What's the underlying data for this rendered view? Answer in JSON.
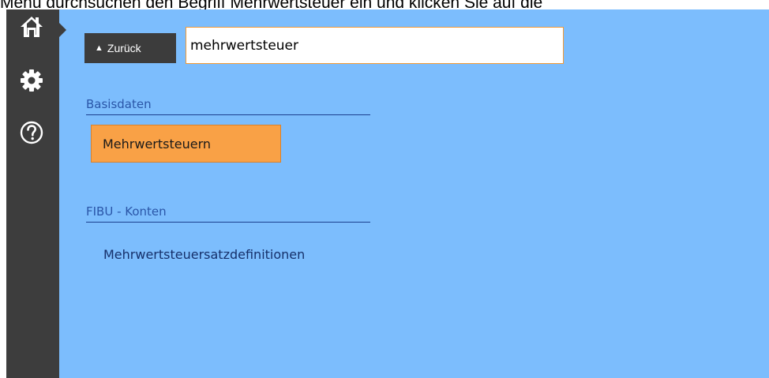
{
  "caption": "Menü durchsuchen den Begriff Mehrwertsteuer ein und klicken Sie auf die",
  "sidebar": {
    "items": [
      {
        "icon": "home-icon"
      },
      {
        "icon": "gear-icon"
      },
      {
        "icon": "help-icon"
      }
    ]
  },
  "toolbar": {
    "back_label": "Zurück"
  },
  "search": {
    "value": "mehrwertsteuer"
  },
  "results": {
    "sections": [
      {
        "title": "Basisdaten",
        "items": [
          "Mehrwertsteuern"
        ]
      },
      {
        "title": "FIBU - Konten",
        "items": [
          "Mehrwertsteuersatzdefinitionen"
        ]
      }
    ]
  },
  "colors": {
    "background": "#7cbdfd",
    "sidebar": "#3d3d3d",
    "accent": "#f9a146",
    "section_title": "#2a56a8"
  }
}
